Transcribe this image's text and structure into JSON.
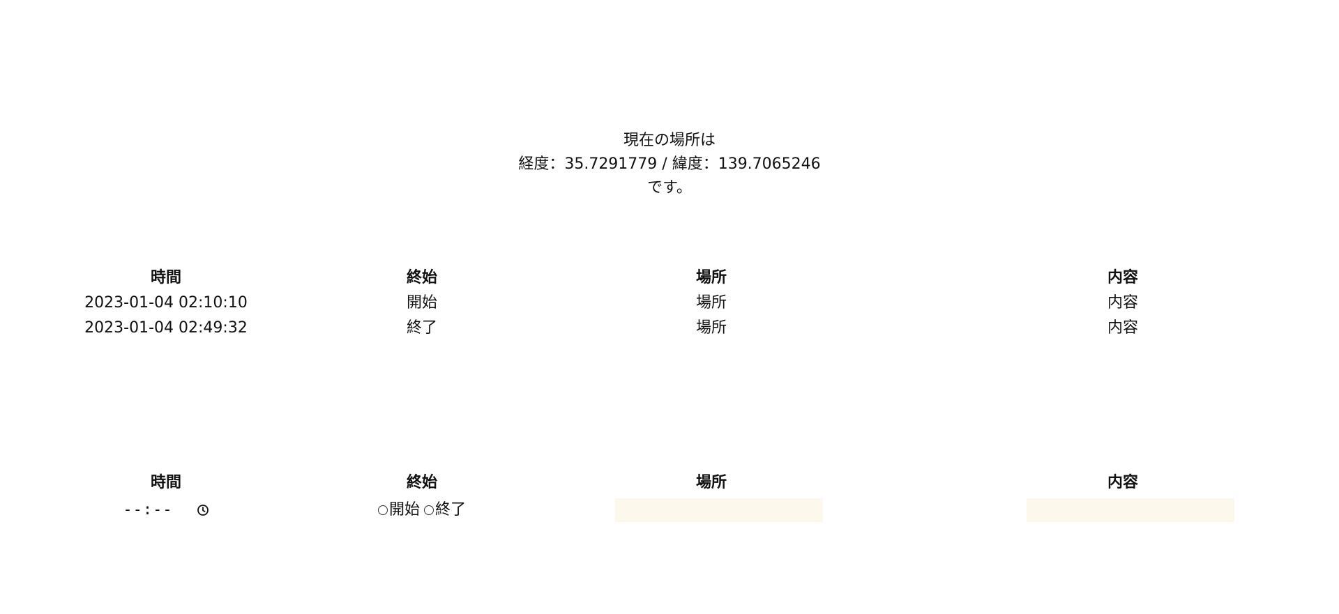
{
  "location": {
    "line1": "現在の場所は",
    "line2": "経度：35.7291779 / 緯度：139.7065246",
    "line3": "です。"
  },
  "log_table": {
    "headers": [
      "時間",
      "終始",
      "場所",
      "内容"
    ],
    "rows": [
      [
        "2023-01-04 02:10:10",
        "開始",
        "場所",
        "内容"
      ],
      [
        "2023-01-04 02:49:32",
        "終了",
        "場所",
        "内容"
      ]
    ]
  },
  "form": {
    "headers": [
      "時間",
      "終始",
      "場所",
      "内容"
    ],
    "time_value": "--:--",
    "radio_start_label": "開始",
    "radio_end_label": "終了",
    "place_value": "",
    "content_value": "",
    "field_bg_color": "#fcf8ec"
  }
}
